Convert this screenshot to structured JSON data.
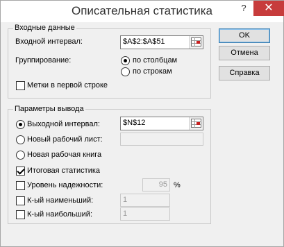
{
  "window": {
    "title": "Описательная статистика",
    "help_icon": "help-icon",
    "close_icon": "close-icon"
  },
  "input_group": {
    "title": "Входные данные",
    "input_range_label": "Входной интервал:",
    "input_range_value": "$A$2:$A$51",
    "grouping_label": "Группирование:",
    "by_columns": "по столбцам",
    "by_rows": "по строкам",
    "labels_first_row": "Метки в первой строке",
    "grouping_selected": "по столбцам",
    "labels_first_row_checked": false
  },
  "output_group": {
    "title": "Параметры вывода",
    "output_range_label": "Выходной интервал:",
    "output_range_value": "$N$12",
    "new_sheet_label": "Новый рабочий лист:",
    "new_sheet_value": "",
    "new_book_label": "Новая рабочая книга",
    "output_selected": "Выходной интервал:",
    "summary_stats": "Итоговая статистика",
    "summary_stats_checked": true,
    "confidence_label": "Уровень надежности:",
    "confidence_value": "95",
    "confidence_unit": "%",
    "confidence_checked": false,
    "kth_smallest_label": "К-ый наименьший:",
    "kth_smallest_value": "1",
    "kth_smallest_checked": false,
    "kth_largest_label": "К-ый наибольший:",
    "kth_largest_value": "1",
    "kth_largest_checked": false
  },
  "buttons": {
    "ok": "OK",
    "cancel": "Отмена",
    "help": "Справка"
  },
  "icons": {
    "range_select": "range-select-icon"
  }
}
